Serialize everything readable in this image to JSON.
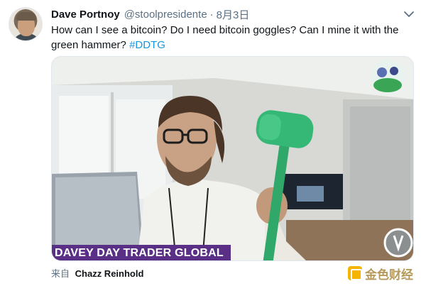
{
  "tweet": {
    "author_name": "Dave Portnoy",
    "handle": "@stoolpresidente",
    "separator": "·",
    "date": "8月3日",
    "text": "How can I see a bitcoin? Do I need bitcoin goggles? Can I mine it with the green hammer? ",
    "hashtag": "#DDTG",
    "media": {
      "banner_text": "DAVEY DAY TRADER GLOBAL"
    },
    "source_prefix": "来自",
    "source_user": "Chazz Reinhold"
  },
  "watermark": {
    "text": "金色财经"
  },
  "icons": {
    "caret": "chevron-down-icon",
    "avatar": "avatar",
    "watermark_logo": "watermark-logo-icon"
  },
  "colors": {
    "hashtag": "#1b95e0",
    "secondary_text": "#5b7083",
    "banner_bg": "#5a2f86",
    "hammer": "#2fa86a",
    "watermark": "#b59a5b"
  }
}
